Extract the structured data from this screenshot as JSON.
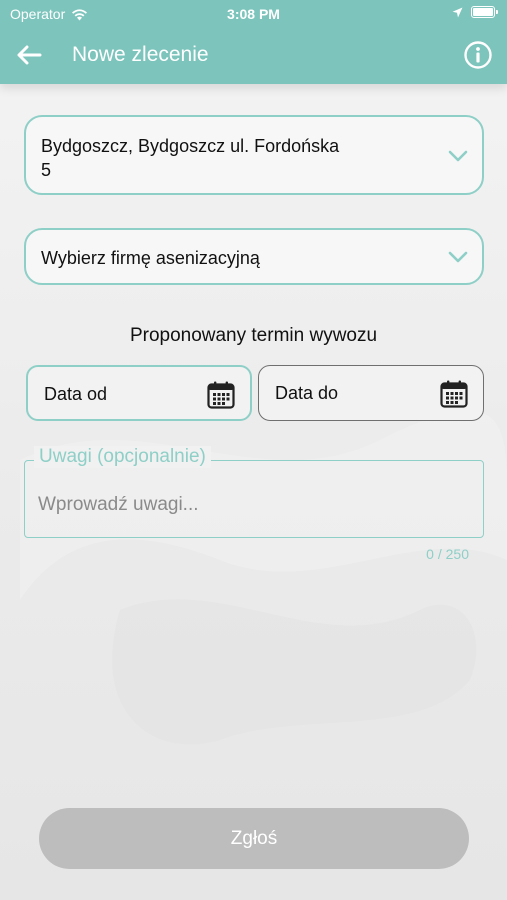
{
  "status_bar": {
    "carrier": "Operator",
    "time": "3:08 PM"
  },
  "header": {
    "title": "Nowe zlecenie",
    "back_icon": "arrow-left-icon",
    "info_icon": "info-circle-icon",
    "color": "#7cc4bc"
  },
  "form": {
    "location": {
      "line1": "Bydgoszcz, Bydgoszcz ul. Fordońska",
      "line2": "5"
    },
    "company": {
      "placeholder": "Wybierz firmę asenizacyjną"
    },
    "term_label": "Proponowany termin wywozu",
    "date_from": {
      "label": "Data od"
    },
    "date_to": {
      "label": "Data do"
    },
    "notes": {
      "legend": "Uwagi (opcjonalnie)",
      "placeholder": "Wprowadź uwagi...",
      "value": "",
      "counter": "0 / 250"
    },
    "submit_label": "Zgłoś"
  },
  "colors": {
    "accent": "#8ecfc7",
    "button_disabled": "#bdbdbd"
  }
}
